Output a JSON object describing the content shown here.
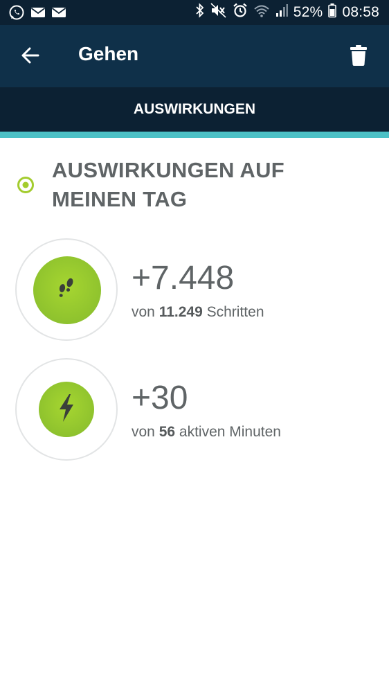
{
  "status_bar": {
    "battery": "52%",
    "time": "08:58",
    "left_icons": [
      "whatsapp-icon",
      "mail-icon",
      "mail-icon"
    ],
    "right_icons": [
      "bluetooth-icon",
      "mute-icon",
      "alarm-icon",
      "wifi-icon",
      "signal-icon",
      "battery-icon"
    ]
  },
  "app_bar": {
    "title": "Gehen",
    "back_icon": "arrow-left-icon",
    "trash_icon": "trash-icon"
  },
  "tabs": [
    {
      "label": "AUSWIRKUNGEN",
      "selected": true
    }
  ],
  "section": {
    "title": "AUSWIRKUNGEN AUF MEINEN TAG"
  },
  "metrics": [
    {
      "icon": "footsteps-icon",
      "value": "+7.448",
      "prefix": "von",
      "total": "11.249",
      "unit": "Schritten"
    },
    {
      "icon": "lightning-icon",
      "value": "+30",
      "prefix": "von",
      "total": "56",
      "unit": "aktiven Minuten"
    }
  ],
  "colors": {
    "status_bar": "#0c2133",
    "app_bar": "#0f3049",
    "tab_indicator": "#4cc1c6",
    "accent_green": "#8dc12e",
    "text_gray": "#5f6466"
  }
}
